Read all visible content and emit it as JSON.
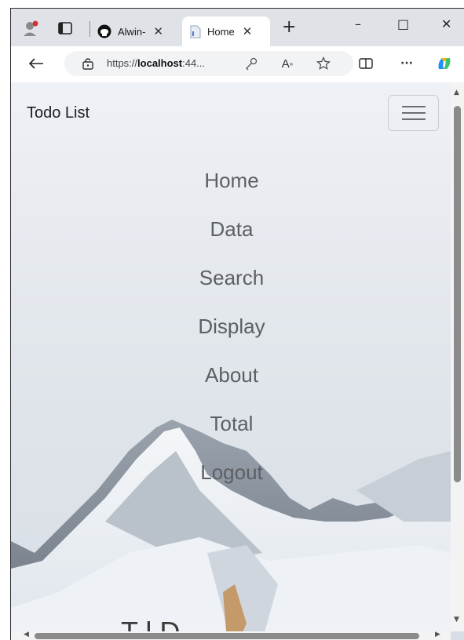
{
  "browser": {
    "tabs": [
      {
        "label": "Alwin-",
        "icon": "github-icon"
      },
      {
        "label": "Home",
        "icon": "page-icon",
        "active": true
      }
    ],
    "new_tab_glyph": "+",
    "window_controls": {
      "minimize": "–",
      "maximize": "□",
      "close": "✕"
    },
    "address": {
      "scheme": "https://",
      "host": "localhost",
      "rest": ":44..."
    },
    "more_glyph": "···"
  },
  "page": {
    "brand": "Todo List",
    "nav_items": [
      "Home",
      "Data",
      "Search",
      "Display",
      "About",
      "Total",
      "Logout"
    ],
    "bottom_heading_partial": "T    l  D"
  },
  "colors": {
    "nav_text": "#5c5f63",
    "brand_text": "#1e1e1e",
    "tabbar_bg": "#dfe3e8"
  }
}
